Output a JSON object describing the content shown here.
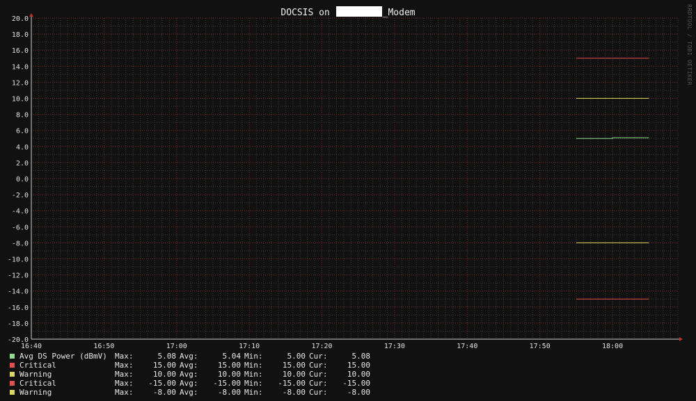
{
  "chart_data": {
    "type": "line",
    "title_prefix": "DOCSIS on ",
    "title_suffix": "_Modem",
    "watermark": "RRDTOOL / TOBI OETIKER",
    "ylim": [
      -20,
      20
    ],
    "y_ticks": [
      "20.0",
      "18.0",
      "16.0",
      "14.0",
      "12.0",
      "10.0",
      "8.0",
      "6.0",
      "4.0",
      "2.0",
      "0.0",
      "-2.0",
      "-4.0",
      "-6.0",
      "-8.0",
      "-10.0",
      "-12.0",
      "-14.0",
      "-16.0",
      "-18.0",
      "-20.0"
    ],
    "x_ticks": [
      "16:40",
      "16:50",
      "17:00",
      "17:10",
      "17:20",
      "17:30",
      "17:40",
      "17:50",
      "18:00"
    ],
    "xlim_minutes": [
      "16:40",
      "18:09"
    ],
    "series": [
      {
        "name": "Avg DS Power (dBmV)",
        "color": "#8fdb8f",
        "x": [
          "17:55",
          "18:00",
          "18:00",
          "18:05"
        ],
        "y": [
          5.0,
          5.0,
          5.08,
          5.08
        ],
        "max": "5.08",
        "avg": "5.04",
        "min": "5.00",
        "cur": "5.08"
      },
      {
        "name": "Critical",
        "color": "#e05050",
        "x": [
          "17:55",
          "18:05"
        ],
        "y": [
          15.0,
          15.0
        ],
        "max": "15.00",
        "avg": "15.00",
        "min": "15.00",
        "cur": "15.00"
      },
      {
        "name": "Warning",
        "color": "#d8d860",
        "x": [
          "17:55",
          "18:05"
        ],
        "y": [
          10.0,
          10.0
        ],
        "max": "10.00",
        "avg": "10.00",
        "min": "10.00",
        "cur": "10.00"
      },
      {
        "name": "Critical",
        "color": "#e05050",
        "x": [
          "17:55",
          "18:05"
        ],
        "y": [
          -15.0,
          -15.0
        ],
        "max": "-15.00",
        "avg": "-15.00",
        "min": "-15.00",
        "cur": "-15.00"
      },
      {
        "name": "Warning",
        "color": "#d8d860",
        "x": [
          "17:55",
          "18:05"
        ],
        "y": [
          -8.0,
          -8.0
        ],
        "max": "-8.00",
        "avg": "-8.00",
        "min": "-8.00",
        "cur": "-8.00"
      }
    ],
    "legend_labels": {
      "max": "Max:",
      "avg": "Avg:",
      "min": "Min:",
      "cur": "Cur:"
    },
    "grid": true
  }
}
